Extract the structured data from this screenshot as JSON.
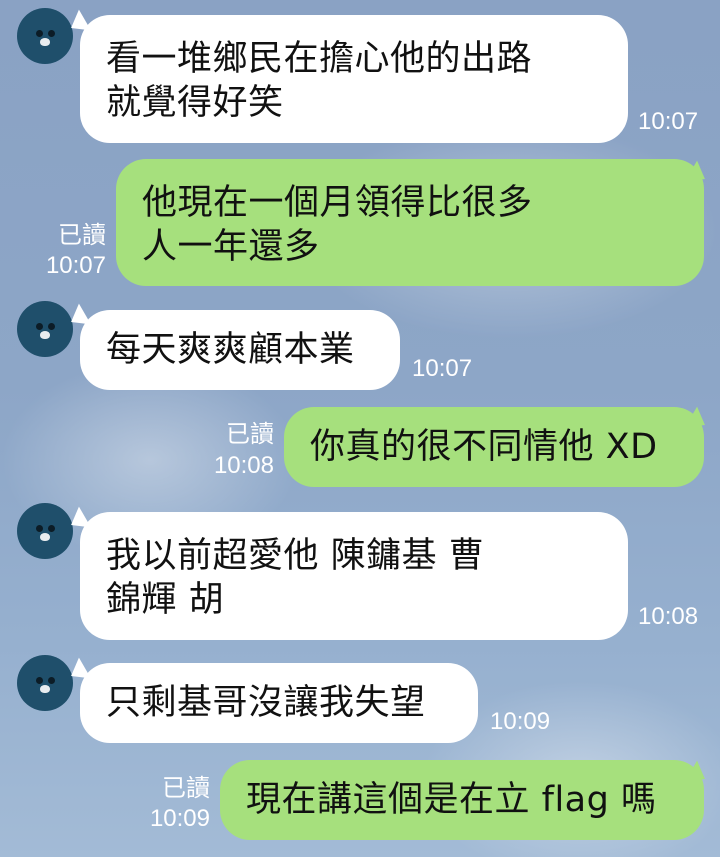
{
  "colors": {
    "background": "#8da6c7",
    "incoming_bubble": "#ffffff",
    "outgoing_bubble": "#a6e07d",
    "avatar": "#1f4f6b",
    "meta_text": "#ffffff"
  },
  "avatar_icon": "bear-face-icon",
  "messages": [
    {
      "dir": "in",
      "lines": [
        "看一堆鄉民在擔心他的出路",
        "就覺得好笑"
      ],
      "time": "10:07"
    },
    {
      "dir": "out",
      "lines": [
        "他現在一個月領得比很多",
        "人一年還多"
      ],
      "read": "已讀",
      "time": "10:07"
    },
    {
      "dir": "in",
      "lines": [
        "每天爽爽顧本業"
      ],
      "time": "10:07"
    },
    {
      "dir": "out",
      "lines": [
        "你真的很不同情他 XD"
      ],
      "read": "已讀",
      "time": "10:08"
    },
    {
      "dir": "in",
      "lines": [
        "我以前超愛他 陳鏞基 曹",
        "錦輝 胡"
      ],
      "time": "10:08"
    },
    {
      "dir": "in",
      "lines": [
        "只剩基哥沒讓我失望"
      ],
      "time": "10:09"
    },
    {
      "dir": "out",
      "lines": [
        "現在講這個是在立 flag 嗎"
      ],
      "read": "已讀",
      "time": "10:09"
    }
  ]
}
